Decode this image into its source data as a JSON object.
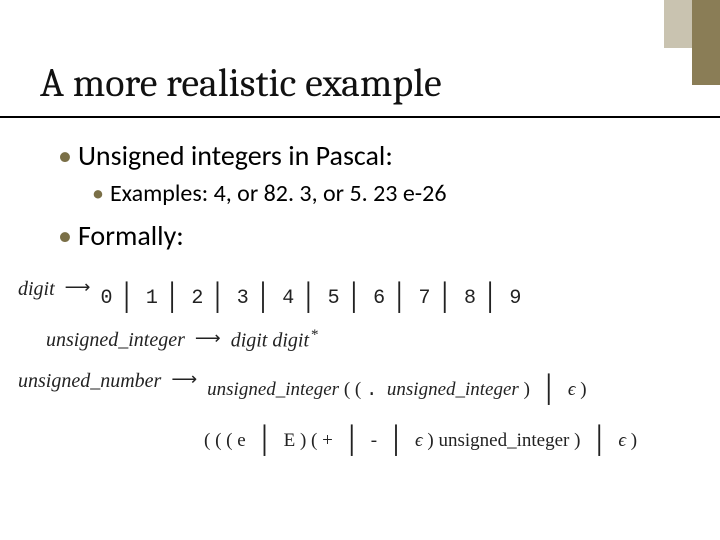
{
  "title": "A more realistic example",
  "bullets": [
    "Unsigned integers in Pascal:",
    "Examples: 4, or 82. 3, or 5. 23 e-26",
    "Formally:"
  ],
  "grammar": {
    "eps": "ϵ",
    "digit": {
      "lhs": "digit",
      "alts": [
        "0",
        "1",
        "2",
        "3",
        "4",
        "5",
        "6",
        "7",
        "8",
        "9"
      ]
    },
    "uint": {
      "lhs": "unsigned_integer",
      "rhs": [
        "digit",
        "digit"
      ]
    },
    "unum": {
      "lhs": "unsigned_number",
      "line1": {
        "a": "unsigned_integer",
        "dot": ".",
        "b": "unsigned_integer"
      },
      "line2": {
        "e": "e",
        "E": "E",
        "plus": "+",
        "minus": "-",
        "c": "unsigned_integer"
      }
    }
  }
}
